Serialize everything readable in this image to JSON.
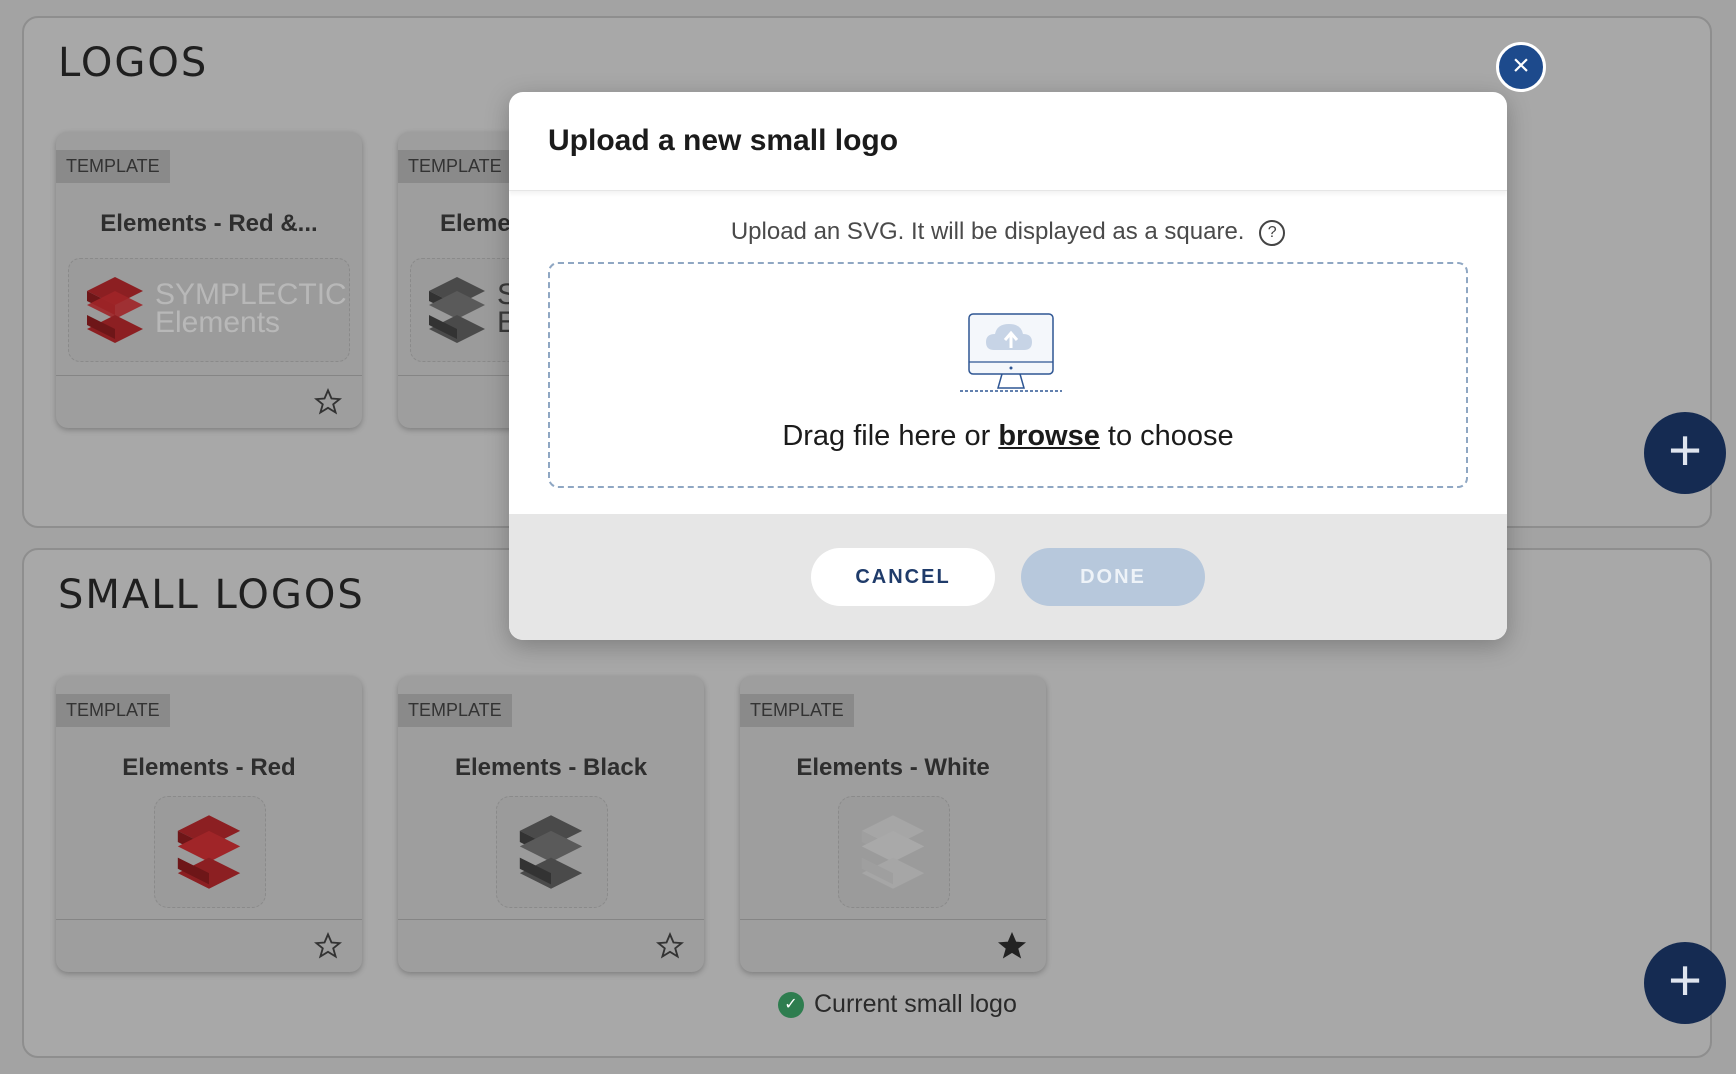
{
  "sections": {
    "logos": {
      "title": "LOGOS",
      "cards": [
        {
          "tag": "TEMPLATE",
          "title": "Elements - Red &...",
          "wordmark_top": "SYMPLECTIC",
          "wordmark_bottom": "Elements"
        },
        {
          "tag": "TEMPLATE",
          "title": "Eleme",
          "wordmark_top": "S",
          "wordmark_bottom": "E"
        }
      ]
    },
    "small_logos": {
      "title": "SMALL LOGOS",
      "cards": [
        {
          "tag": "TEMPLATE",
          "title": "Elements - Red"
        },
        {
          "tag": "TEMPLATE",
          "title": "Elements - Black"
        },
        {
          "tag": "TEMPLATE",
          "title": "Elements - White"
        }
      ],
      "current_note": "Current small logo"
    }
  },
  "modal": {
    "title": "Upload a new small logo",
    "helper": "Upload an SVG. It will be displayed as a square.",
    "help_symbol": "?",
    "drop_text_before": "Drag file here or ",
    "drop_link": "browse",
    "drop_text_after": " to choose",
    "cancel_label": "CANCEL",
    "done_label": "DONE",
    "close_symbol": "×"
  },
  "fab_symbol": "+",
  "colors": {
    "brand_red": "#8c1f22",
    "navy": "#152b52",
    "close_blue": "#1d4a8c",
    "success_green": "#2e7d4f"
  }
}
